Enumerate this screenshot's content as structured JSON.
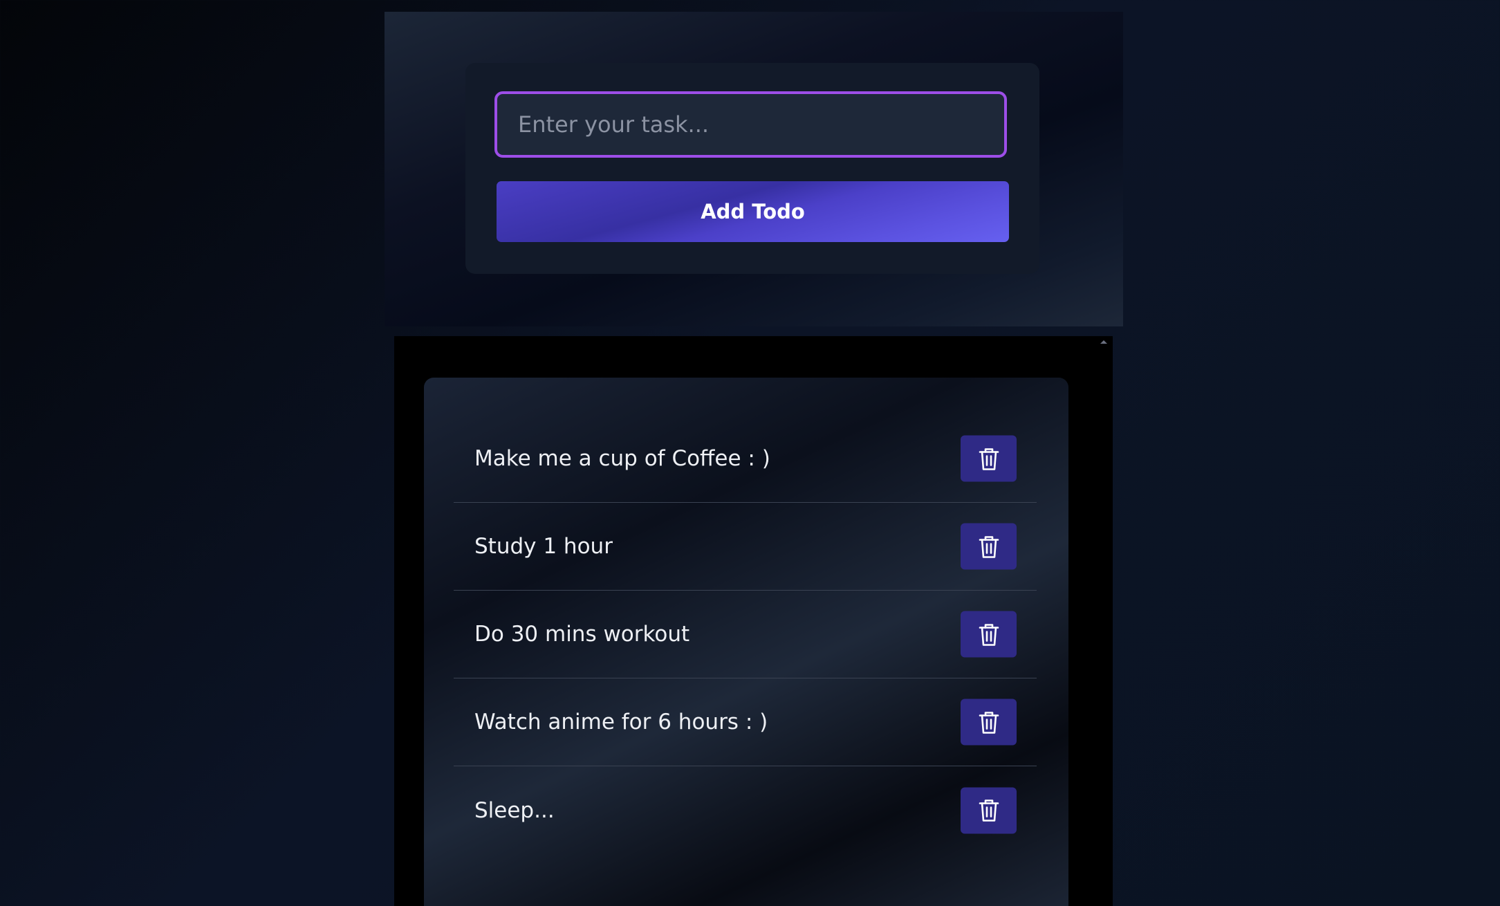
{
  "input": {
    "placeholder": "Enter your task...",
    "value": ""
  },
  "add_button": {
    "label": "Add Todo"
  },
  "todos": [
    {
      "text": "Make me a cup of Coffee : )"
    },
    {
      "text": "Study 1 hour"
    },
    {
      "text": "Do 30 mins workout"
    },
    {
      "text": "Watch anime for 6 hours : )"
    },
    {
      "text": "Sleep..."
    }
  ],
  "icons": {
    "delete": "trash-icon"
  },
  "colors": {
    "accent_border": "#9d4ee8",
    "button_gradient_start": "#3730a3",
    "button_gradient_end": "#6660f0",
    "delete_button": "#2f2a86"
  }
}
